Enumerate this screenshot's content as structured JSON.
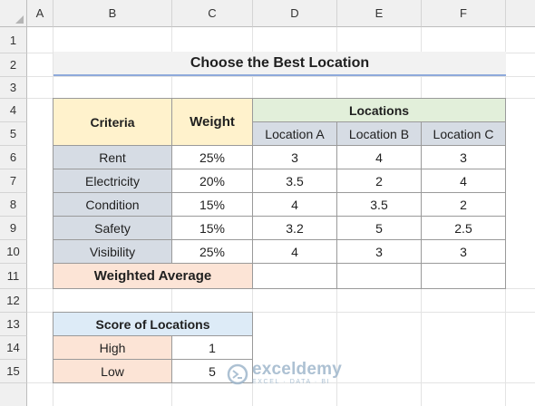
{
  "columns": [
    "A",
    "B",
    "C",
    "D",
    "E",
    "F"
  ],
  "rows": [
    "1",
    "2",
    "3",
    "4",
    "5",
    "6",
    "7",
    "8",
    "9",
    "10",
    "11",
    "12",
    "13",
    "14",
    "15"
  ],
  "title": "Choose the Best Location",
  "table": {
    "criteria_header": "Criteria",
    "weight_header": "Weight",
    "locations_header": "Locations",
    "location_names": [
      "Location A",
      "Location B",
      "Location C"
    ],
    "rows": [
      {
        "criteria": "Rent",
        "weight": "25%",
        "values": [
          "3",
          "4",
          "3"
        ]
      },
      {
        "criteria": "Electricity",
        "weight": "20%",
        "values": [
          "3.5",
          "2",
          "4"
        ]
      },
      {
        "criteria": "Condition",
        "weight": "15%",
        "values": [
          "4",
          "3.5",
          "2"
        ]
      },
      {
        "criteria": "Safety",
        "weight": "15%",
        "values": [
          "3.2",
          "5",
          "2.5"
        ]
      },
      {
        "criteria": "Visibility",
        "weight": "25%",
        "values": [
          "4",
          "3",
          "3"
        ]
      }
    ],
    "weighted_average_label": "Weighted Average"
  },
  "score": {
    "header": "Score of Locations",
    "rows": [
      {
        "label": "High",
        "value": "1"
      },
      {
        "label": "Low",
        "value": "5"
      }
    ]
  },
  "watermark": {
    "name": "exceldemy",
    "tagline": "EXCEL · DATA · BI"
  },
  "colors": {
    "header_yellow": "#fff2cc",
    "header_green": "#e2efda",
    "criteria_gray": "#d6dce4",
    "salmon": "#fce4d6",
    "score_blue": "#ddebf7",
    "title_underline": "#8ea9db"
  }
}
